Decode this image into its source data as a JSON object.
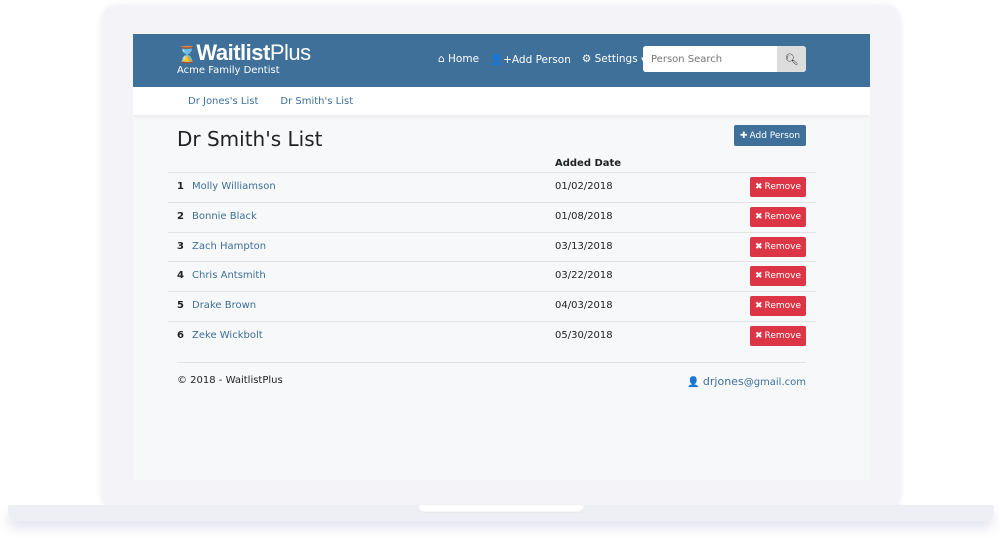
{
  "brand": {
    "name_bold": "Waitlist",
    "name_light": "Plus",
    "subtitle": "Acme Family Dentist"
  },
  "nav": {
    "home": "Home",
    "add_person": "Add Person",
    "settings": "Settings",
    "search_placeholder": "Person Search"
  },
  "subnav": [
    "Dr Jones's List",
    "Dr Smith's List"
  ],
  "page": {
    "title": "Dr Smith's List",
    "add_button": "Add Person",
    "col_added": "Added Date",
    "remove_label": "Remove"
  },
  "rows": [
    {
      "n": "1",
      "name": "Molly Williamson",
      "date": "01/02/2018"
    },
    {
      "n": "2",
      "name": "Bonnie Black",
      "date": "01/08/2018"
    },
    {
      "n": "3",
      "name": "Zach Hampton",
      "date": "03/13/2018"
    },
    {
      "n": "4",
      "name": "Chris Antsmith",
      "date": "03/22/2018"
    },
    {
      "n": "5",
      "name": "Drake Brown",
      "date": "04/03/2018"
    },
    {
      "n": "6",
      "name": "Zeke Wickbolt",
      "date": "05/30/2018"
    }
  ],
  "footer": {
    "copyright": "© 2018 - WaitlistPlus",
    "user": "drjones",
    "domain": "@gmail.com"
  },
  "colors": {
    "primary": "#3e7099",
    "danger": "#dc3545"
  }
}
